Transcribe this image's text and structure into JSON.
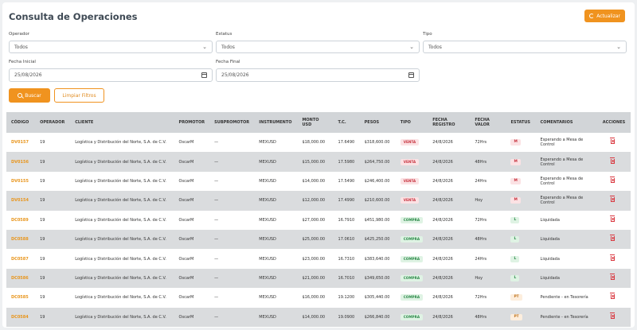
{
  "header": {
    "title": "Consulta de Operaciones",
    "refresh_label": "Actualizar"
  },
  "filters": {
    "operador": {
      "label": "Operador",
      "value": "Todos"
    },
    "estatus": {
      "label": "Estatus",
      "value": "Todos"
    },
    "tipo": {
      "label": "Tipo",
      "value": "Todos"
    },
    "fecha_inicial": {
      "label": "Fecha Inicial",
      "value": "25/08/2026"
    },
    "fecha_final": {
      "label": "Fecha Final",
      "value": "25/08/2026"
    },
    "buscar_label": "Buscar",
    "limpiar_label": "Limpiar Filtros"
  },
  "table": {
    "columns": [
      "CÓDIGO",
      "OPERADOR",
      "CLIENTE",
      "PROMOTOR",
      "SUBPROMOTOR",
      "INSTRUMENTO",
      "MONTO USD",
      "T.C.",
      "PESOS",
      "TIPO",
      "FECHA REGISTRO",
      "FECHA VALOR",
      "ESTATUS",
      "COMENTARIOS",
      "ACCIONES"
    ],
    "rows": [
      {
        "code": "DV0157",
        "op": "19",
        "cliente": "Logística y Distribución del Norte, S.A. de C.V.",
        "prom": "OscarM",
        "sub": "—",
        "inst": "MEXUSD",
        "monto": "$18,000.00",
        "tc": "17.6490",
        "pesos": "$318,600.00",
        "tipo": "VENTA",
        "freg": "24/8/2026",
        "fval": "72Hrs",
        "estatus": "M",
        "coment": "Esperando a Mesa de Control"
      },
      {
        "code": "DV0156",
        "op": "19",
        "cliente": "Logística y Distribución del Norte, S.A. de C.V.",
        "prom": "OscarM",
        "sub": "—",
        "inst": "MEXUSD",
        "monto": "$15,000.00",
        "tc": "17.5980",
        "pesos": "$264,750.00",
        "tipo": "VENTA",
        "freg": "24/8/2026",
        "fval": "48Hrs",
        "estatus": "M",
        "coment": "Esperando a Mesa de Control"
      },
      {
        "code": "DV0155",
        "op": "19",
        "cliente": "Logística y Distribución del Norte, S.A. de C.V.",
        "prom": "OscarM",
        "sub": "—",
        "inst": "MEXUSD",
        "monto": "$14,000.00",
        "tc": "17.5490",
        "pesos": "$246,400.00",
        "tipo": "VENTA",
        "freg": "24/8/2026",
        "fval": "24Hrs",
        "estatus": "M",
        "coment": "Esperando a Mesa de Control"
      },
      {
        "code": "DV0154",
        "op": "19",
        "cliente": "Logística y Distribución del Norte, S.A. de C.V.",
        "prom": "OscarM",
        "sub": "—",
        "inst": "MEXUSD",
        "monto": "$12,000.00",
        "tc": "17.4990",
        "pesos": "$210,600.00",
        "tipo": "VENTA",
        "freg": "24/8/2026",
        "fval": "Hoy",
        "estatus": "M",
        "coment": "Esperando a Mesa de Control"
      },
      {
        "code": "DC0589",
        "op": "19",
        "cliente": "Logística y Distribución del Norte, S.A. de C.V.",
        "prom": "OscarM",
        "sub": "—",
        "inst": "MEXUSD",
        "monto": "$27,000.00",
        "tc": "16.7910",
        "pesos": "$451,980.00",
        "tipo": "COMPRA",
        "freg": "24/8/2026",
        "fval": "72Hrs",
        "estatus": "L",
        "coment": "Liquidada"
      },
      {
        "code": "DC0588",
        "op": "19",
        "cliente": "Logística y Distribución del Norte, S.A. de C.V.",
        "prom": "OscarM",
        "sub": "—",
        "inst": "MEXUSD",
        "monto": "$25,000.00",
        "tc": "17.0610",
        "pesos": "$425,250.00",
        "tipo": "COMPRA",
        "freg": "24/8/2026",
        "fval": "48Hrs",
        "estatus": "L",
        "coment": "Liquidada"
      },
      {
        "code": "DC0587",
        "op": "19",
        "cliente": "Logística y Distribución del Norte, S.A. de C.V.",
        "prom": "OscarM",
        "sub": "—",
        "inst": "MEXUSD",
        "monto": "$23,000.00",
        "tc": "16.7310",
        "pesos": "$383,640.00",
        "tipo": "COMPRA",
        "freg": "24/8/2026",
        "fval": "24Hrs",
        "estatus": "L",
        "coment": "Liquidada"
      },
      {
        "code": "DC0586",
        "op": "19",
        "cliente": "Logística y Distribución del Norte, S.A. de C.V.",
        "prom": "OscarM",
        "sub": "—",
        "inst": "MEXUSD",
        "monto": "$21,000.00",
        "tc": "16.7010",
        "pesos": "$349,650.00",
        "tipo": "COMPRA",
        "freg": "24/8/2026",
        "fval": "Hoy",
        "estatus": "L",
        "coment": "Liquidada"
      },
      {
        "code": "DC0585",
        "op": "19",
        "cliente": "Logística y Distribución del Norte, S.A. de C.V.",
        "prom": "OscarM",
        "sub": "—",
        "inst": "MEXUSD",
        "monto": "$16,000.00",
        "tc": "19.1200",
        "pesos": "$305,440.00",
        "tipo": "COMPRA",
        "freg": "24/8/2026",
        "fval": "72Hrs",
        "estatus": "PT",
        "coment": "Pendiente - en Tesorería"
      },
      {
        "code": "DC0584",
        "op": "19",
        "cliente": "Logística y Distribución del Norte, S.A. de C.V.",
        "prom": "OscarM",
        "sub": "—",
        "inst": "MEXUSD",
        "monto": "$14,000.00",
        "tc": "19.0900",
        "pesos": "$266,840.00",
        "tipo": "COMPRA",
        "freg": "24/8/2026",
        "fval": "48Hrs",
        "estatus": "PT",
        "coment": "Pendiente - en Tesorería"
      }
    ]
  }
}
